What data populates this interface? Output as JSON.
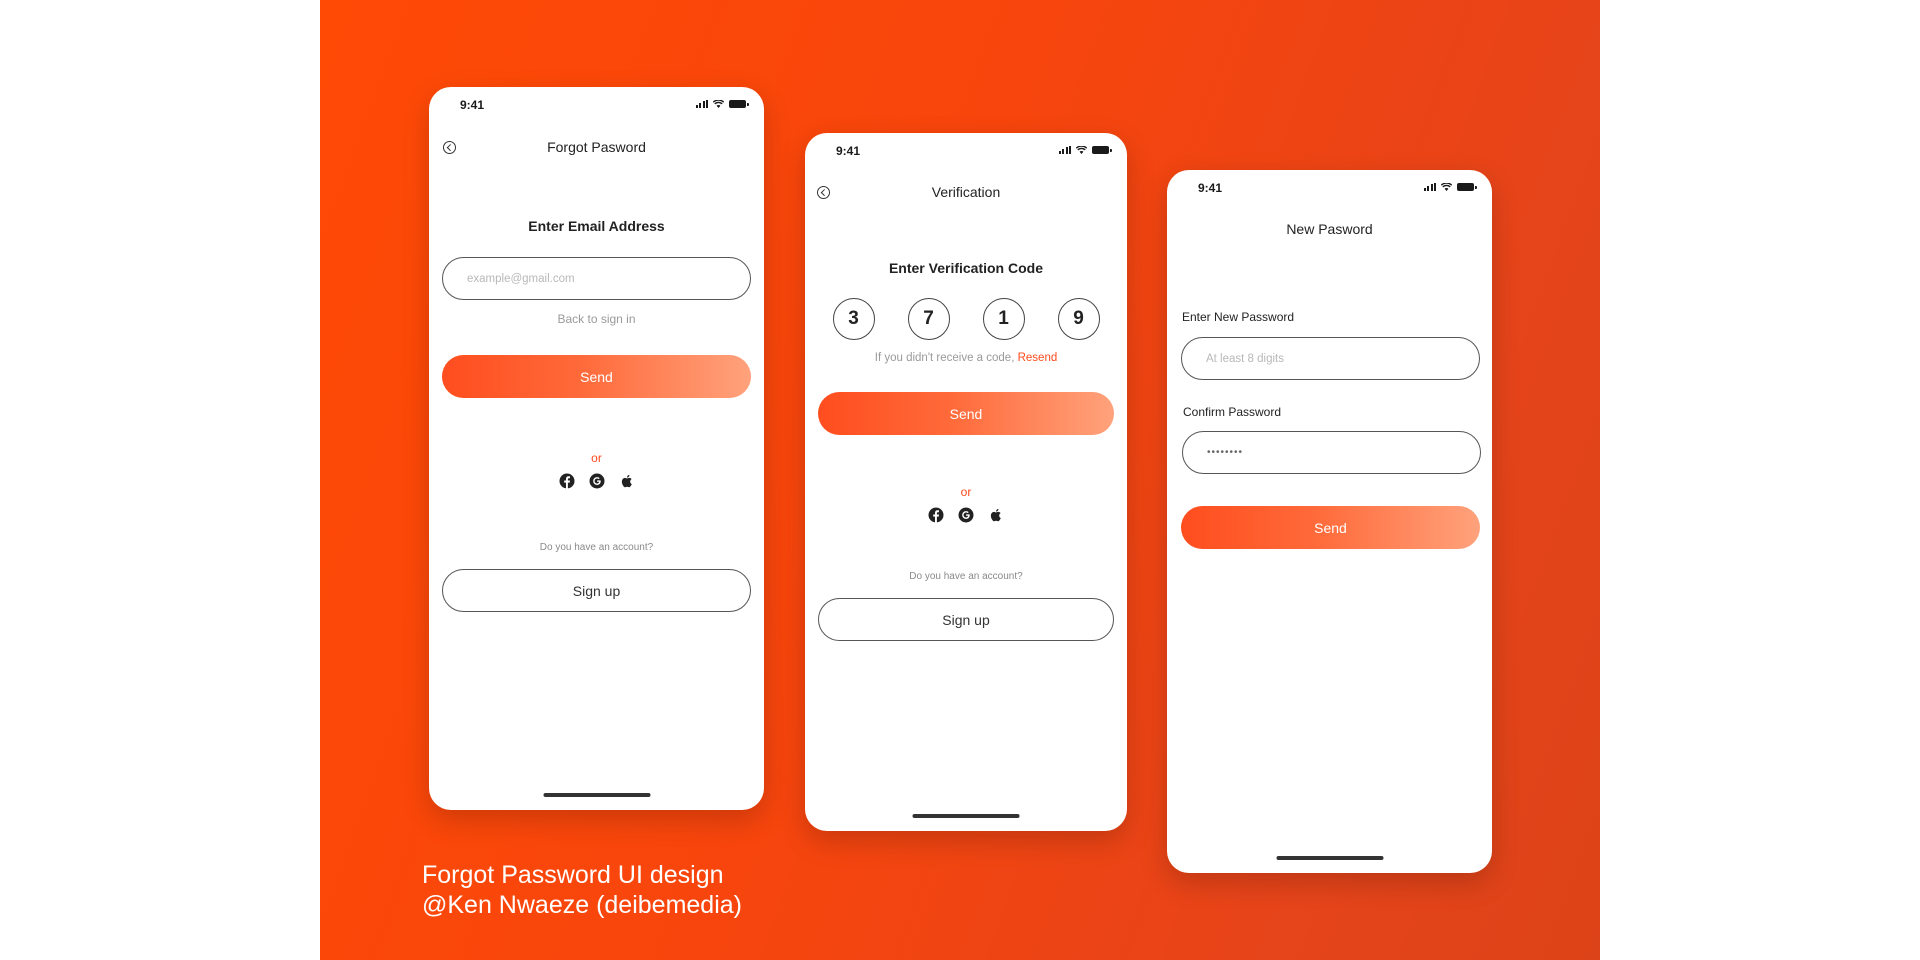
{
  "status_time": "9:41",
  "colors": {
    "accent": "#ff4a1c",
    "background": "#f4480d",
    "card": "#ffffff"
  },
  "screen1": {
    "title": "Forgot Pasword",
    "heading": "Enter Email Address",
    "email_placeholder": "example@gmail.com",
    "back_to_sign_in": "Back to sign in",
    "send_label": "Send",
    "or_label": "or",
    "social_icons": [
      "facebook-icon",
      "google-icon",
      "apple-icon"
    ],
    "account_prompt": "Do you have an account?",
    "signup_label": "Sign up"
  },
  "screen2": {
    "title": "Verification",
    "heading": "Enter Verification Code",
    "code_digits": [
      "3",
      "7",
      "1",
      "9"
    ],
    "resend_prompt": "If you didn't receive a code, ",
    "resend_link": "Resend",
    "send_label": "Send",
    "or_label": "or",
    "social_icons": [
      "facebook-icon",
      "google-icon",
      "apple-icon"
    ],
    "account_prompt": "Do you have an account?",
    "signup_label": "Sign up"
  },
  "screen3": {
    "title": "New Pasword",
    "new_password_label": "Enter New Password",
    "new_password_placeholder": "At least 8 digits",
    "confirm_password_label": "Confirm Password",
    "confirm_password_value": "••••••••",
    "send_label": "Send"
  },
  "caption": {
    "line1": "Forgot Password UI design",
    "line2": "@Ken Nwaeze (deibemedia)"
  }
}
